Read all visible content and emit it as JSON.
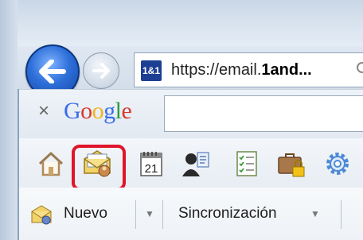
{
  "navigation": {
    "url_prefix": "https://email.",
    "url_domain": "1and...",
    "favicon_text": "1&1"
  },
  "google_toolbar": {
    "close_label": "×",
    "logo_letters": [
      "G",
      "o",
      "o",
      "g",
      "l",
      "e"
    ],
    "logo_colors": [
      "#3b6ee8",
      "#d63a2f",
      "#f1b51c",
      "#3b6ee8",
      "#2f9a42",
      "#d63a2f"
    ]
  },
  "favorites": [
    {
      "name": "home-icon"
    },
    {
      "name": "mail-icon",
      "highlighted": true
    },
    {
      "name": "calendar-icon",
      "text": "21"
    },
    {
      "name": "contacts-icon"
    },
    {
      "name": "tasks-icon"
    },
    {
      "name": "briefcase-lock-icon"
    },
    {
      "name": "gear-icon"
    }
  ],
  "command_bar": {
    "new_label": "Nuevo",
    "new_arrow": "▼",
    "sync_label": "Sincronización",
    "sync_arrow": "▼"
  },
  "colors": {
    "highlight": "#e0142a",
    "back_button": "#2e6fd9"
  }
}
